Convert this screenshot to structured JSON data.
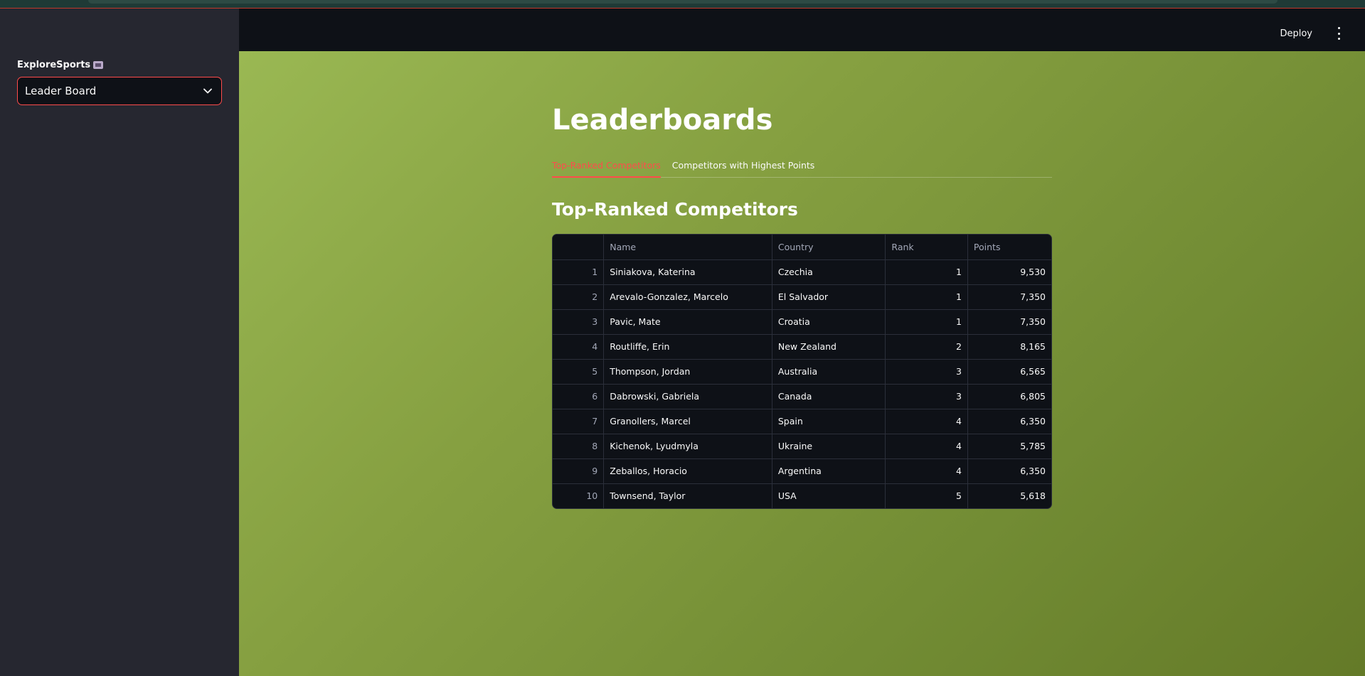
{
  "sidebar": {
    "label": "ExploreSports",
    "select": {
      "value": "Leader Board"
    }
  },
  "header": {
    "deploy_label": "Deploy"
  },
  "main": {
    "title": "Leaderboards",
    "tabs": [
      {
        "label": "Top-Ranked Competitors",
        "active": true
      },
      {
        "label": "Competitors with Highest Points",
        "active": false
      }
    ],
    "section_title": "Top-Ranked Competitors",
    "table": {
      "columns": [
        "",
        "Name",
        "Country",
        "Rank",
        "Points"
      ],
      "rows": [
        {
          "idx": "1",
          "name": "Siniakova, Katerina",
          "country": "Czechia",
          "rank": "1",
          "points": "9,530"
        },
        {
          "idx": "2",
          "name": "Arevalo-Gonzalez, Marcelo",
          "country": "El Salvador",
          "rank": "1",
          "points": "7,350"
        },
        {
          "idx": "3",
          "name": "Pavic, Mate",
          "country": "Croatia",
          "rank": "1",
          "points": "7,350"
        },
        {
          "idx": "4",
          "name": "Routliffe, Erin",
          "country": "New Zealand",
          "rank": "2",
          "points": "8,165"
        },
        {
          "idx": "5",
          "name": "Thompson, Jordan",
          "country": "Australia",
          "rank": "3",
          "points": "6,565"
        },
        {
          "idx": "6",
          "name": "Dabrowski, Gabriela",
          "country": "Canada",
          "rank": "3",
          "points": "6,805"
        },
        {
          "idx": "7",
          "name": "Granollers, Marcel",
          "country": "Spain",
          "rank": "4",
          "points": "6,350"
        },
        {
          "idx": "8",
          "name": "Kichenok, Lyudmyla",
          "country": "Ukraine",
          "rank": "4",
          "points": "5,785"
        },
        {
          "idx": "9",
          "name": "Zeballos, Horacio",
          "country": "Argentina",
          "rank": "4",
          "points": "6,350"
        },
        {
          "idx": "10",
          "name": "Townsend, Taylor",
          "country": "USA",
          "rank": "5",
          "points": "5,618"
        }
      ]
    }
  },
  "icons": {
    "select": "chevron-down-icon",
    "menu": "kebab-menu-icon",
    "label_emoji": "emoji-icon"
  },
  "colors": {
    "accent": "#ff4b4b",
    "sidebar_bg": "#262730",
    "header_bg": "#0e1117",
    "main_gradient_start": "#9ab853",
    "main_gradient_end": "#647a28"
  }
}
